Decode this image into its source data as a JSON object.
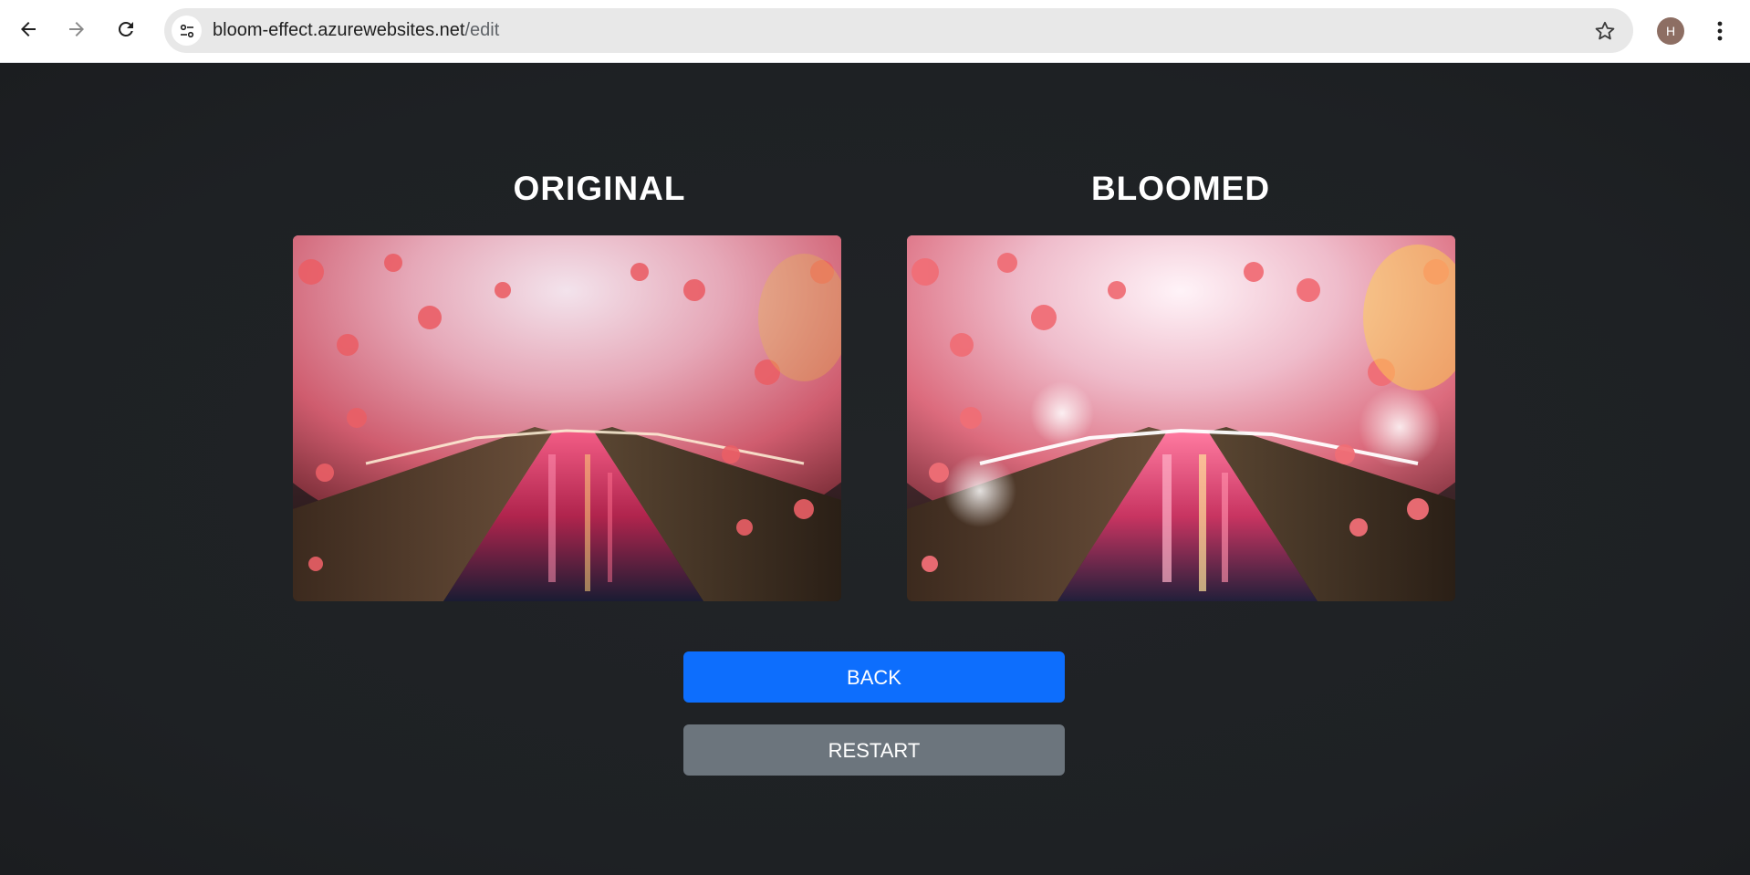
{
  "browser": {
    "url_host": "bloom-effect.azurewebsites.net",
    "url_path": "/edit",
    "profile_initial": "H",
    "icons": {
      "back": "arrow-left-icon",
      "forward": "arrow-right-icon",
      "reload": "reload-icon",
      "site_info": "tune-icon",
      "bookmark": "star-icon",
      "menu": "kebab-menu-icon"
    }
  },
  "main": {
    "original_title": "ORIGINAL",
    "bloomed_title": "BLOOMED",
    "back_label": "BACK",
    "restart_label": "RESTART"
  },
  "colors": {
    "page_background": "#202326",
    "back_button": "#0d6efd",
    "restart_button": "#6c757d"
  }
}
